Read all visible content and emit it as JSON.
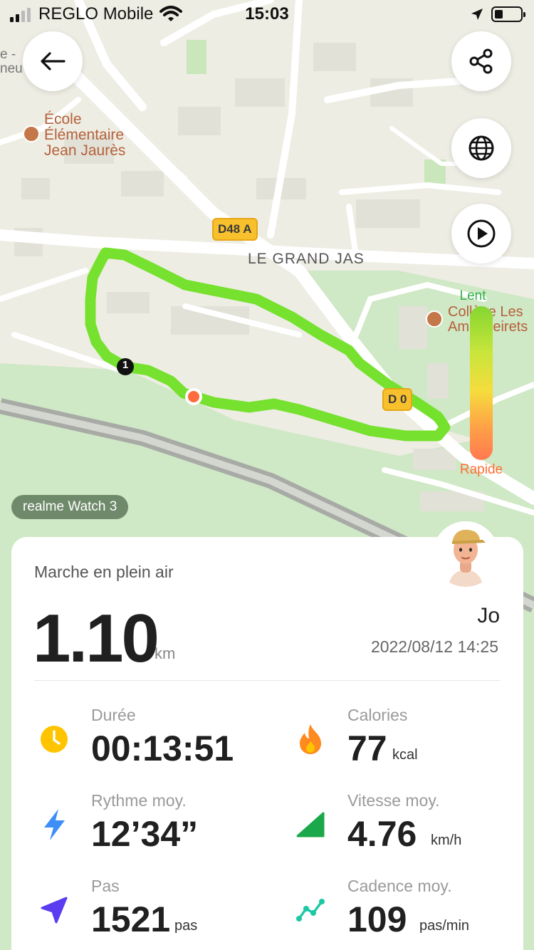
{
  "status_bar": {
    "carrier": "REGLO Mobile",
    "time": "15:03"
  },
  "map": {
    "school_label_line1": "École",
    "school_label_line2": "Élémentaire",
    "school_label_line3": "Jean Jaurès",
    "neighborhood_label": "LE GRAND JAS",
    "road_badge": "D48 A",
    "road_badge_2": "D 0",
    "college_label_line1": "Collège Les",
    "college_label_line2": "Amandeirets",
    "edge_label_1": "e -",
    "edge_label_2": "neu",
    "start_marker": "1"
  },
  "speed_legend": {
    "slow_label": "Lent",
    "fast_label": "Rapide"
  },
  "device_chip": "realme Watch 3",
  "summary": {
    "activity_type": "Marche en plein air",
    "distance": "1.10",
    "distance_unit": "km",
    "user_name": "Jo",
    "datetime": "2022/08/12 14:25"
  },
  "stats": {
    "duration": {
      "label": "Durée",
      "value": "00:13:51",
      "icon": "clock-icon",
      "color": "#ffc400"
    },
    "calories": {
      "label": "Calories",
      "value": "77",
      "unit": "kcal",
      "icon": "flame-icon",
      "color": "#ff8a1f"
    },
    "pace": {
      "label": "Rythme moy.",
      "value": "12’34”",
      "icon": "lightning-icon",
      "color": "#3d8ef7"
    },
    "speed": {
      "label": "Vitesse moy.",
      "value": "4.76",
      "unit": "km/h",
      "icon": "speed-triangle-icon",
      "color": "#1aa84a"
    },
    "steps": {
      "label": "Pas",
      "value": "1521",
      "unit": "pas",
      "icon": "navigation-arrow-icon",
      "color": "#5b3cf0"
    },
    "cadence": {
      "label": "Cadence moy.",
      "value": "109",
      "unit": "pas/min",
      "icon": "cadence-graph-icon",
      "color": "#1bc7a5"
    }
  },
  "colors": {
    "route": "#6fe024",
    "start_marker": "#111111",
    "end_marker": "#ff6b3d"
  }
}
